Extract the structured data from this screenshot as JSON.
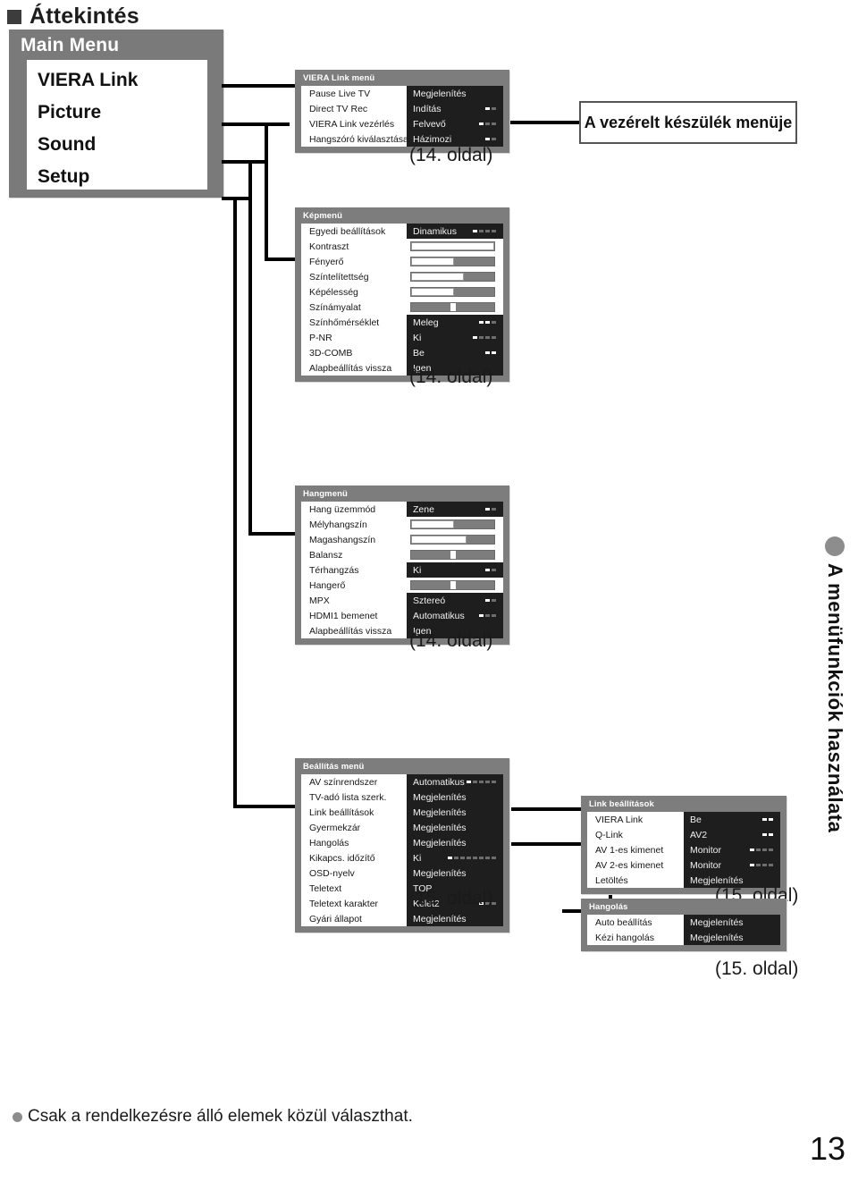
{
  "heading": {
    "text": "Áttekintés",
    "bullet": "filled-square"
  },
  "main_menu": {
    "title": "Main Menu",
    "items": [
      {
        "label": "VIERA Link"
      },
      {
        "label": "Picture"
      },
      {
        "label": "Sound"
      },
      {
        "label": "Setup"
      }
    ]
  },
  "controlled_device_box": {
    "label": "A vezérelt készülék menüje"
  },
  "page_refs": {
    "viera_link": "(14. oldal)",
    "picture": "(14. oldal)",
    "sound": "(14. oldal)",
    "setup": "(15. oldal)",
    "link_settings": "(15. oldal)",
    "tuning": "(15. oldal)"
  },
  "menus": {
    "viera_link": {
      "title": "VIERA Link menü",
      "rows": [
        {
          "label": "Pause Live TV",
          "value": "Megjelenítés",
          "dash": null
        },
        {
          "label": "Direct TV Rec",
          "value": "Indítás",
          "dash": {
            "total": 2,
            "active": 1
          }
        },
        {
          "label": "VIERA Link vezérlés",
          "value": "Felvevő",
          "dash": {
            "total": 3,
            "active": 1
          }
        },
        {
          "label": "Hangszóró kiválasztása",
          "value": "Házimozi",
          "dash": {
            "total": 2,
            "active": 1
          }
        }
      ]
    },
    "picture": {
      "title": "Képmenü",
      "rows": [
        {
          "label": "Egyedi beállítások",
          "type": "value",
          "value": "Dinamikus",
          "dash": {
            "total": 4,
            "active": 1
          }
        },
        {
          "label": "Kontraszt",
          "type": "slider",
          "fill": 100,
          "knob": null
        },
        {
          "label": "Fényerő",
          "type": "slider",
          "fill": 52,
          "knob": null
        },
        {
          "label": "Színtelítettség",
          "type": "slider",
          "fill": 63,
          "knob": null
        },
        {
          "label": "Képélesség",
          "type": "slider",
          "fill": 52,
          "knob": null
        },
        {
          "label": "Színámyalat",
          "type": "slider",
          "fill": 0,
          "knob": 47
        },
        {
          "label": "Színhőmérséklet",
          "type": "value",
          "value": "Meleg",
          "dash": {
            "total": 3,
            "active": 2
          }
        },
        {
          "label": "P-NR",
          "type": "value",
          "value": "Ki",
          "dash": {
            "total": 4,
            "active": 1
          }
        },
        {
          "label": "3D-COMB",
          "type": "value",
          "value": "Be",
          "dash": {
            "total": 2,
            "active": 2
          }
        },
        {
          "label": "Alapbeállítás vissza",
          "type": "value",
          "value": "Igen",
          "dash": null
        }
      ]
    },
    "sound": {
      "title": "Hangmenü",
      "rows": [
        {
          "label": "Hang üzemmód",
          "type": "value",
          "value": "Zene",
          "dash": {
            "total": 2,
            "active": 1
          }
        },
        {
          "label": "Mélyhangszín",
          "type": "slider",
          "fill": 52,
          "knob": null
        },
        {
          "label": "Magashangszín",
          "type": "slider",
          "fill": 67,
          "knob": null
        },
        {
          "label": "Balansz",
          "type": "slider",
          "fill": 0,
          "knob": 47
        },
        {
          "label": "Térhangzás",
          "type": "value",
          "value": "Ki",
          "dash": {
            "total": 2,
            "active": 1
          }
        },
        {
          "label": "Hangerő",
          "type": "slider",
          "fill": 0,
          "knob": 47
        },
        {
          "label": "MPX",
          "type": "value",
          "value": "Sztereó",
          "dash": {
            "total": 2,
            "active": 1
          }
        },
        {
          "label": "HDMI1 bemenet",
          "type": "value",
          "value": "Automatikus",
          "dash": {
            "total": 3,
            "active": 1
          }
        },
        {
          "label": "Alapbeállítás vissza",
          "type": "value",
          "value": "Igen",
          "dash": null
        }
      ]
    },
    "setup": {
      "title": "Beállítás menü",
      "rows": [
        {
          "label": "AV színrendszer",
          "value": "Automatikus",
          "dash": {
            "total": 5,
            "active": 1
          }
        },
        {
          "label": "TV-adó lista szerk.",
          "value": "Megjelenítés",
          "dash": null
        },
        {
          "label": "Link beállítások",
          "value": "Megjelenítés",
          "dash": null
        },
        {
          "label": "Gyermekzár",
          "value": "Megjelenítés",
          "dash": null
        },
        {
          "label": "Hangolás",
          "value": "Megjelenítés",
          "dash": null
        },
        {
          "label": "Kikapcs. időzítő",
          "value": "Ki",
          "dash": {
            "total": 8,
            "active": 1
          }
        },
        {
          "label": "OSD-nyelv",
          "value": "Megjelenítés",
          "dash": null
        },
        {
          "label": "Teletext",
          "value": "TOP",
          "dash": null
        },
        {
          "label": "Teletext karakter",
          "value": "Kelet2",
          "dash": {
            "total": 3,
            "active": 1
          }
        },
        {
          "label": "Gyári állapot",
          "value": "Megjelenítés",
          "dash": null
        }
      ]
    },
    "link_settings": {
      "title": "Link beállítások",
      "rows": [
        {
          "label": "VIERA Link",
          "value": "Be",
          "dash": {
            "total": 2,
            "active": 2
          }
        },
        {
          "label": "Q-Link",
          "value": "AV2",
          "dash": {
            "total": 2,
            "active": 2
          }
        },
        {
          "label": "AV 1-es kimenet",
          "value": "Monitor",
          "dash": {
            "total": 4,
            "active": 1
          }
        },
        {
          "label": "AV 2-es kimenet",
          "value": "Monitor",
          "dash": {
            "total": 4,
            "active": 1
          }
        },
        {
          "label": "Letöltés",
          "value": "Megjelenítés",
          "dash": null
        }
      ]
    },
    "tuning": {
      "title": "Hangolás",
      "rows": [
        {
          "label": "Auto beállítás",
          "value": "Megjelenítés",
          "dash": null
        },
        {
          "label": "Kézi hangolás",
          "value": "Megjelenítés",
          "dash": null
        }
      ]
    }
  },
  "side_tab": {
    "text": "A menüfunkciók használata",
    "bullet": "filled-circle"
  },
  "footer": {
    "note": "Csak a rendelkezésre álló elemek közül választhat.",
    "bullet": "filled-circle"
  },
  "page_number": "13"
}
